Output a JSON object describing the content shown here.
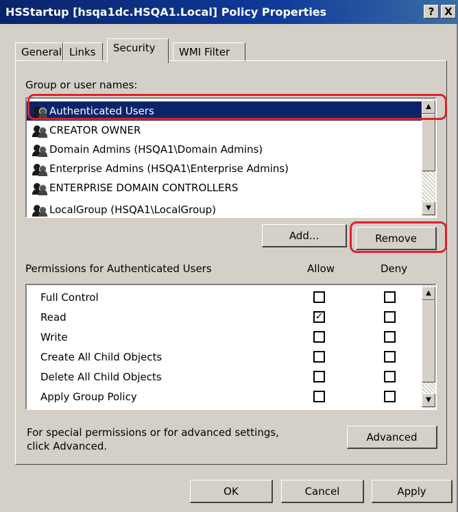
{
  "window": {
    "title": "HSStartup [hsqa1dc.HSQA1.Local] Policy Properties",
    "help_button": "?",
    "close_button": "X"
  },
  "tabs": [
    {
      "label": "General"
    },
    {
      "label": "Links"
    },
    {
      "label": "Security",
      "active": true
    },
    {
      "label": "WMI Filter"
    }
  ],
  "security": {
    "group_label": "Group or user names:",
    "users": [
      {
        "name": "Authenticated Users",
        "selected": true
      },
      {
        "name": "CREATOR OWNER"
      },
      {
        "name": "Domain Admins (HSQA1\\Domain Admins)"
      },
      {
        "name": "Enterprise Admins (HSQA1\\Enterprise Admins)"
      },
      {
        "name": "ENTERPRISE DOMAIN CONTROLLERS"
      },
      {
        "name": "LocalGroup (HSQA1\\LocalGroup)"
      }
    ],
    "add_button": "Add...",
    "remove_button": "Remove",
    "permissions_label": "Permissions for Authenticated Users",
    "allow_header": "Allow",
    "deny_header": "Deny",
    "permissions": [
      {
        "name": "Full Control",
        "allow": false,
        "deny": false
      },
      {
        "name": "Read",
        "allow": true,
        "deny": false
      },
      {
        "name": "Write",
        "allow": false,
        "deny": false
      },
      {
        "name": "Create All Child Objects",
        "allow": false,
        "deny": false
      },
      {
        "name": "Delete All Child Objects",
        "allow": false,
        "deny": false
      },
      {
        "name": "Apply Group Policy",
        "allow": false,
        "deny": false
      }
    ],
    "advanced_text_line1": "For special permissions or for advanced settings,",
    "advanced_text_line2": "click Advanced.",
    "advanced_button": "Advanced"
  },
  "footer": {
    "ok_button": "OK",
    "cancel_button": "Cancel",
    "apply_button": "Apply"
  },
  "annotation_color": "#e0202a"
}
